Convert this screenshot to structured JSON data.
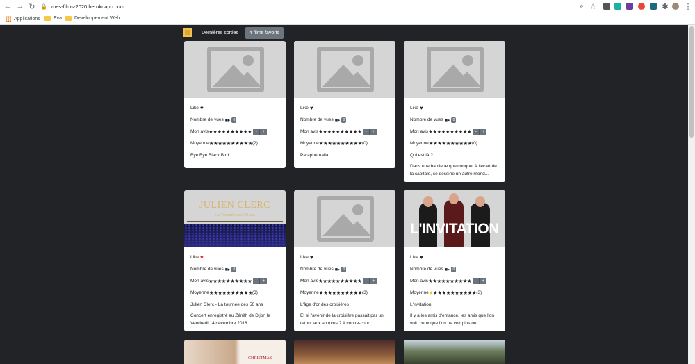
{
  "browser": {
    "url": "mes-films-2020.herokuapp.com",
    "bookmarks": [
      "Applications",
      "Eva",
      "Developpement Web"
    ]
  },
  "nav": {
    "latest": "Dernières sorties",
    "favorites": "4 films favoris"
  },
  "labels": {
    "like": "Like",
    "views": "Nombre de vues",
    "my_review": "Mon avis",
    "average": "Moyenne",
    "minus": "-",
    "plus": "+",
    "stars": "★★★★★★★★★★"
  },
  "cards": [
    {
      "views": "0",
      "avg_count": "(2)",
      "title": "Bye Bye Black Bird",
      "desc": "",
      "liked": false
    },
    {
      "views": "0",
      "avg_count": "(0)",
      "title": "Paraphernalia",
      "desc": "",
      "liked": false
    },
    {
      "views": "0",
      "avg_count": "(0)",
      "title": "Qui est là ?",
      "desc": "Dans une banlieue quelconque, à l'écart de la capitale, se dessine un autre mond...",
      "liked": false
    },
    {
      "views": "0",
      "avg_count": "(3)",
      "title": "Julien Clerc - La tournée des 50 ans",
      "desc": "Concert enregistré au Zénith de Dijon le Vendredi 14 décembre 2018",
      "liked": true,
      "img_title": "JULIEN CLERC",
      "img_sub": "La Tournée des 50 ans"
    },
    {
      "views": "0",
      "avg_count": "(3)",
      "title": "L'âge d'or des croisières",
      "desc": "Et si l'avenir de la croisière passait par un retour aux sources ? A contre-cour...",
      "liked": false
    },
    {
      "views": "0",
      "avg_count": "(3)",
      "title": "L'invitation",
      "desc": "Il y a les amis d'enfance, les amis que l'on voit, ceux que l'on ne voit plus ou...",
      "liked": false,
      "img_title": "L'INVITATION"
    }
  ],
  "bottom_partial": {
    "poster_text": "CHRISTMAS"
  },
  "colors": {
    "bg": "#212327",
    "like_red": "#e3342f",
    "star_gold": "#f5c518"
  }
}
